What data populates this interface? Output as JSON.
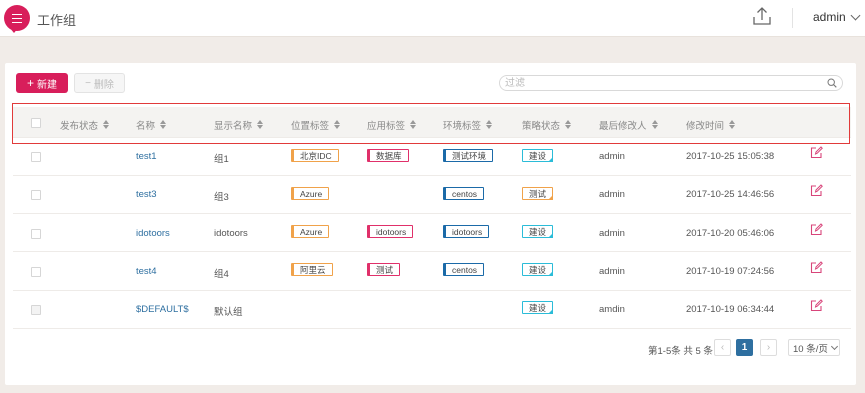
{
  "app": {
    "title": "工作组",
    "user": "admin"
  },
  "toolbar": {
    "new_label": "新建",
    "delete_label": "删除",
    "search_placeholder": "过滤"
  },
  "table": {
    "headers": [
      "发布状态",
      "名称",
      "显示名称",
      "位置标签",
      "应用标签",
      "环境标签",
      "策略状态",
      "最后修改人",
      "修改时间"
    ],
    "rows": [
      {
        "name": "test1",
        "display": "组1",
        "location": "北京IDC",
        "app": "数据库",
        "env": "测试环境",
        "policy": "建设",
        "policy_type": "build",
        "modifier": "admin",
        "time": "2017-10-25 15:05:38"
      },
      {
        "name": "test3",
        "display": "组3",
        "location": "Azure",
        "app": "",
        "env": "centos",
        "policy": "测试",
        "policy_type": "test",
        "modifier": "admin",
        "time": "2017-10-25 14:46:56"
      },
      {
        "name": "idotoors",
        "display": "idotoors",
        "location": "Azure",
        "app": "idotoors",
        "env": "idotoors",
        "policy": "建设",
        "policy_type": "build",
        "modifier": "admin",
        "time": "2017-10-20 05:46:06"
      },
      {
        "name": "test4",
        "display": "组4",
        "location": "阿里云",
        "app": "测试",
        "env": "centos",
        "policy": "建设",
        "policy_type": "build",
        "modifier": "admin",
        "time": "2017-10-19 07:24:56"
      },
      {
        "name": "$DEFAULT$",
        "display": "默认组",
        "location": "",
        "app": "",
        "env": "",
        "policy": "建设",
        "policy_type": "build",
        "modifier": "amdin",
        "time": "2017-10-19 06:34:44"
      }
    ]
  },
  "pagination": {
    "summary": "第1-5条 共 5 条",
    "prev": "‹",
    "current": "1",
    "next": "›",
    "page_size": "10 条/页"
  },
  "colors": {
    "brand": "#d81e5b",
    "link": "#2e6fa0",
    "location_tag": "#f0a24a",
    "app_tag": "#e0306a",
    "env_tag": "#1b6aa8",
    "policy_tag": "#2bbcd8"
  },
  "icons": {
    "menu": "menu-icon",
    "upload": "upload-icon",
    "search": "search-icon",
    "edit": "edit-icon"
  }
}
